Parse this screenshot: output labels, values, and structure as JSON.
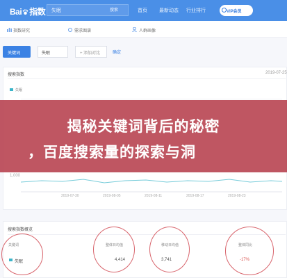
{
  "header": {
    "logo_text": "Bai",
    "logo_suffix": "指数",
    "search_value": "失眠",
    "search_button": "搜索",
    "nav": [
      "首页",
      "最新动态",
      "行业排行"
    ],
    "pill_label": "VIP会员"
  },
  "subnav": {
    "items": [
      "指数研究",
      "需求图谱",
      "人群画像"
    ]
  },
  "controls": {
    "keyword_button": "关键词",
    "keyword_value": "失眠",
    "add_compare": "+ 添加对比",
    "confirm": "确定"
  },
  "trend_panel": {
    "title": "搜索指数",
    "date": "2019-07-25",
    "legend": "失眠",
    "y_tick": "1,000",
    "x_ticks": [
      "2019-07-30",
      "2019-08-05",
      "2019-08-11",
      "2019-08-17",
      "2019-08-23"
    ]
  },
  "banner": {
    "line1": "揭秘关键词背后的秘密",
    "line2": "，百度搜索量的探索与洞"
  },
  "overview": {
    "title": "搜索指数概览",
    "headers": [
      "关键词",
      "整体日均值",
      "移动日均值",
      "整体同比"
    ],
    "row": {
      "keyword": "失眠",
      "overall_daily": "4,414",
      "mobile_daily": "3,741",
      "yoy": "-17%"
    }
  },
  "colors": {
    "brand_blue": "#4a8fe7",
    "banner_red": "#b43a48",
    "series_teal": "#3bb5c9",
    "highlight_circle": "#d8646c"
  }
}
